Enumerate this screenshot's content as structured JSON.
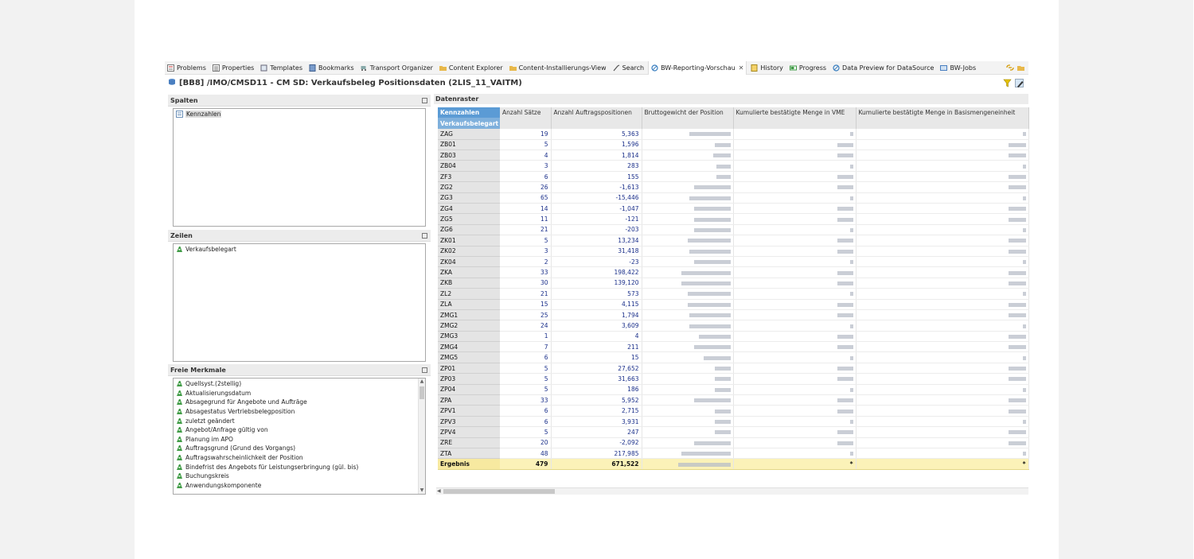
{
  "tabs": [
    {
      "label": "Problems",
      "icon": "problems-icon"
    },
    {
      "label": "Properties",
      "icon": "properties-icon"
    },
    {
      "label": "Templates",
      "icon": "templates-icon"
    },
    {
      "label": "Bookmarks",
      "icon": "bookmarks-icon"
    },
    {
      "label": "Transport Organizer",
      "icon": "transport-icon"
    },
    {
      "label": "Content Explorer",
      "icon": "content-explorer-icon"
    },
    {
      "label": "Content-Installierungs-View",
      "icon": "content-install-icon"
    },
    {
      "label": "Search",
      "icon": "search-icon"
    },
    {
      "label": "BW-Reporting-Vorschau",
      "icon": "reporting-icon",
      "active": true
    },
    {
      "label": "History",
      "icon": "history-icon"
    },
    {
      "label": "Progress",
      "icon": "progress-icon"
    },
    {
      "label": "Data Preview for DataSource",
      "icon": "data-preview-icon"
    },
    {
      "label": "BW-Jobs",
      "icon": "jobs-icon"
    }
  ],
  "view_title": "[BB8] /IMO/CMSD11 - CM SD: Verkaufsbeleg Positionsdaten (2LIS_11_VAITM)",
  "panes": {
    "spalten": {
      "title": "Spalten",
      "items": [
        "Kennzahlen"
      ]
    },
    "zeilen": {
      "title": "Zeilen",
      "items": [
        "Verkaufsbelegart"
      ]
    },
    "freie": {
      "title": "Freie Merkmale",
      "items": [
        "Quellsyst.(2stellig)",
        "Aktualisierungsdatum",
        "Absagegrund für Angebote und Aufträge",
        "Absagestatus Vertriebsbelegposition",
        "zuletzt geändert",
        "Angebot/Anfrage gültig von",
        "Planung im APO",
        "Auftragsgrund (Grund des Vorgangs)",
        "Auftragswahrscheinlichkeit der Position",
        "Bindefrist des Angebots für Leistungserbringung (gül. bis)",
        "Buchungskreis",
        "Anwendungskomponente"
      ]
    }
  },
  "datenraster": {
    "title": "Datenraster",
    "header_kennzahlen": "Kennzahlen",
    "header_row_dim": "Verkaufsbelegart",
    "columns": [
      "Anzahl Sätze",
      "Anzahl Auftragspositionen",
      "Bruttogewicht der Position",
      "Kumulierte bestätigte Menge in VME",
      "Kumulierte bestätigte Menge in Basismengeneinheit"
    ],
    "rows": [
      {
        "key": "ZAG",
        "saetze": "19",
        "positionen": "5,363"
      },
      {
        "key": "ZB01",
        "saetze": "5",
        "positionen": "1,596"
      },
      {
        "key": "ZB03",
        "saetze": "4",
        "positionen": "1,814"
      },
      {
        "key": "ZB04",
        "saetze": "3",
        "positionen": "283"
      },
      {
        "key": "ZF3",
        "saetze": "6",
        "positionen": "155"
      },
      {
        "key": "ZG2",
        "saetze": "26",
        "positionen": "-1,613"
      },
      {
        "key": "ZG3",
        "saetze": "65",
        "positionen": "-15,446"
      },
      {
        "key": "ZG4",
        "saetze": "14",
        "positionen": "-1,047"
      },
      {
        "key": "ZG5",
        "saetze": "11",
        "positionen": "-121"
      },
      {
        "key": "ZG6",
        "saetze": "21",
        "positionen": "-203"
      },
      {
        "key": "ZK01",
        "saetze": "5",
        "positionen": "13,234"
      },
      {
        "key": "ZK02",
        "saetze": "3",
        "positionen": "31,418"
      },
      {
        "key": "ZK04",
        "saetze": "2",
        "positionen": "-23"
      },
      {
        "key": "ZKA",
        "saetze": "33",
        "positionen": "198,422"
      },
      {
        "key": "ZKB",
        "saetze": "30",
        "positionen": "139,120"
      },
      {
        "key": "ZL2",
        "saetze": "21",
        "positionen": "573"
      },
      {
        "key": "ZLA",
        "saetze": "15",
        "positionen": "4,115"
      },
      {
        "key": "ZMG1",
        "saetze": "25",
        "positionen": "1,794"
      },
      {
        "key": "ZMG2",
        "saetze": "24",
        "positionen": "3,609"
      },
      {
        "key": "ZMG3",
        "saetze": "1",
        "positionen": "4"
      },
      {
        "key": "ZMG4",
        "saetze": "7",
        "positionen": "211"
      },
      {
        "key": "ZMG5",
        "saetze": "6",
        "positionen": "15"
      },
      {
        "key": "ZP01",
        "saetze": "5",
        "positionen": "27,652"
      },
      {
        "key": "ZP03",
        "saetze": "5",
        "positionen": "31,663"
      },
      {
        "key": "ZP04",
        "saetze": "5",
        "positionen": "186"
      },
      {
        "key": "ZPA",
        "saetze": "33",
        "positionen": "5,952"
      },
      {
        "key": "ZPV1",
        "saetze": "6",
        "positionen": "2,715"
      },
      {
        "key": "ZPV3",
        "saetze": "6",
        "positionen": "3,931"
      },
      {
        "key": "ZPV4",
        "saetze": "5",
        "positionen": "247"
      },
      {
        "key": "ZRE",
        "saetze": "20",
        "positionen": "-2,092"
      },
      {
        "key": "ZTA",
        "saetze": "48",
        "positionen": "217,985"
      }
    ],
    "total": {
      "key": "Ergebnis",
      "saetze": "479",
      "positionen": "671,522",
      "vme": "*",
      "basis": "*"
    }
  },
  "colors": {
    "header_blue": "#5b9bd5",
    "total_yellow": "#fbf2b8",
    "number_blue": "#1a2f8a"
  }
}
